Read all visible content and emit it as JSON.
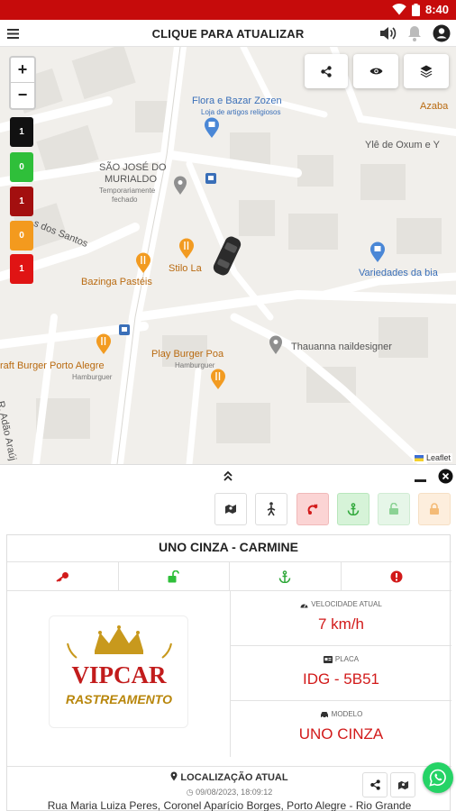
{
  "status_bar": {
    "time": "8:40",
    "background": "#c60b0b"
  },
  "app_bar": {
    "title": "CLIQUE PARA ATUALIZAR"
  },
  "map": {
    "zoom_in": "+",
    "zoom_out": "−",
    "counters": [
      {
        "value": "1",
        "color": "#111111"
      },
      {
        "value": "0",
        "color": "#2fbf3a"
      },
      {
        "value": "1",
        "color": "#a30f0f"
      },
      {
        "value": "0",
        "color": "#f39a1e"
      },
      {
        "value": "1",
        "color": "#e01414"
      }
    ],
    "places": {
      "flora_name": "Flora e Bazar Zozen",
      "flora_desc": "Loja de artigos religiosos",
      "azaba": "Azaba",
      "yle": "Ylê de Oxum e Y",
      "sao_jose_1": "SÃO JOSÉ DO",
      "sao_jose_2": "MURIALDO",
      "temp_closed": "Temporariamente",
      "fechado": "fechado",
      "street_santos": "s dos Santos",
      "stilo": "Stilo La",
      "bazinga": "Bazinga Pastéis",
      "variedades": "Variedades da bia",
      "play_burger": "Play Burger Poa",
      "play_burger_sub": "Hamburguer",
      "thauanna": "Thauanna naildesigner",
      "craft_burger": "raft Burger Porto Alegre",
      "craft_burger_sub": "Hamburguer",
      "street_adao": "R. Adão Araúj"
    },
    "attribution": "Leaflet"
  },
  "vehicle": {
    "name": "UNO CINZA - CARMINE",
    "speed_label": "VELOCIDADE ATUAL",
    "speed_value": "7 km/h",
    "plate_label": "PLACA",
    "plate_value": "IDG - 5B51",
    "model_label": "MODELO",
    "model_value": "UNO CINZA"
  },
  "logo": {
    "brand": "VIPCAR",
    "sub": "RASTREAMENTO"
  },
  "location": {
    "heading": "LOCALIZAÇÃO ATUAL",
    "timestamp": "09/08/2023, 18:09:12",
    "address": "Rua Maria Luiza Peres, Coronel Aparício Borges, Porto Alegre - Rio Grande"
  },
  "icons": {
    "menu": "hamburger-menu-icon",
    "volume": "volume-icon",
    "bell": "bell-icon",
    "account": "account-icon"
  }
}
